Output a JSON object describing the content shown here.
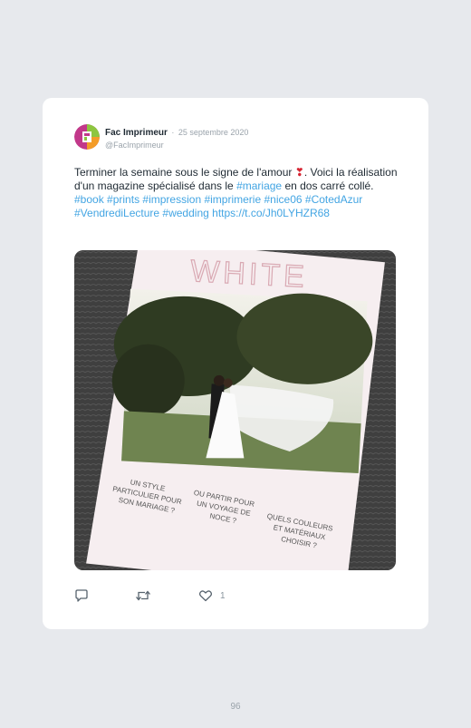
{
  "tweet": {
    "author_name": "Fac Imprimeur",
    "date": "25 septembre 2020",
    "handle": "@FacImprimeur",
    "text_part1": "Terminer la semaine sous le signe de l'amour ",
    "emoji": "❣",
    "text_part2": ". Voici la réalisation d'un magazine spécialisé dans le ",
    "hashtag_mariage": "#mariage",
    "text_part3": " en dos carré collé.",
    "hashtags": [
      "#book",
      "#prints",
      "#impression",
      "#imprimerie",
      "#nice06",
      "#CotedAzur",
      "#VendrediLecture",
      "#wedding"
    ],
    "url": "https://t.co/Jh0LYHZR68"
  },
  "photo": {
    "magazine_title": "WHITE",
    "cover_line_1": "UN STYLE PARTICULIER POUR SON MARIAGE ?",
    "cover_line_2": "OU PARTIR POUR UN VOYAGE DE NOCE ?",
    "cover_line_3": "QUELS COULEURS ET MATÉRIAUX CHOISIR ?"
  },
  "actions": {
    "reply_icon": "comment-icon",
    "retweet_icon": "retweet-icon",
    "like_icon": "heart-icon",
    "like_count": "1"
  },
  "page_number": "96",
  "colors": {
    "link": "#43a5e3",
    "background": "#e7e9ed",
    "card": "#ffffff"
  }
}
